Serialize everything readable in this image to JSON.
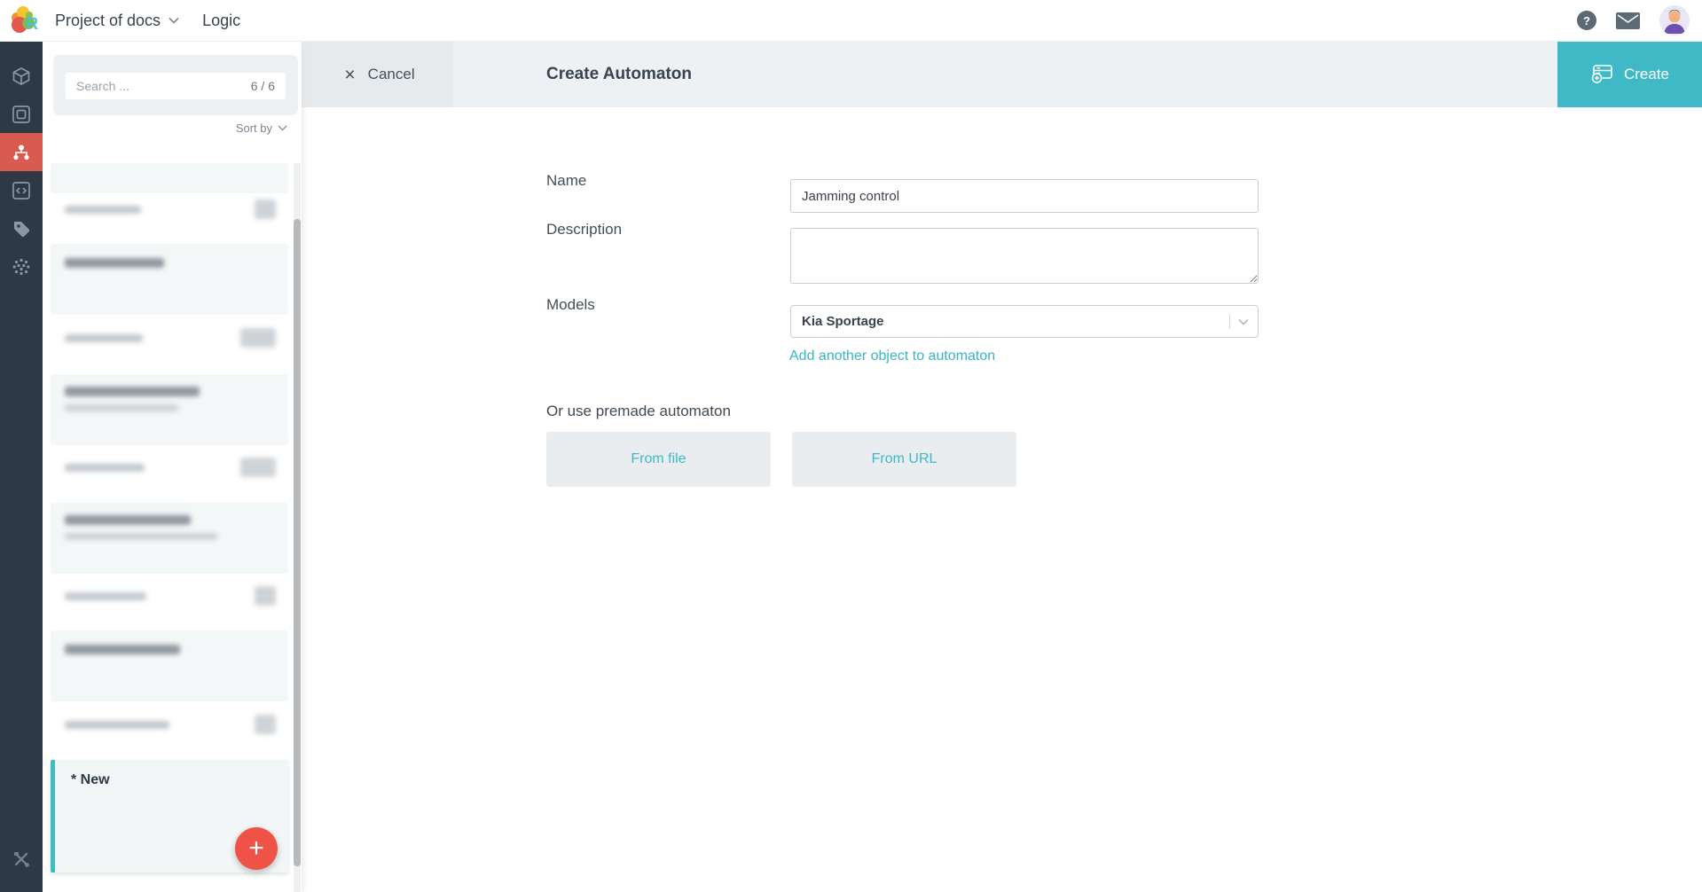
{
  "topbar": {
    "project_name": "Project of docs",
    "section": "Logic",
    "help_glyph": "?"
  },
  "panel": {
    "search_placeholder": "Search ...",
    "search_value": "",
    "counter": "6 / 6",
    "sort_label": "Sort by",
    "new_item_label": "* New",
    "add_button_glyph": "+"
  },
  "header": {
    "cancel_glyph": "×",
    "cancel_label": "Cancel",
    "title": "Create Automaton",
    "create_label": "Create"
  },
  "form": {
    "name_label": "Name",
    "name_value": "Jamming control",
    "description_label": "Description",
    "description_value": "",
    "models_label": "Models",
    "models_value": "Kia Sportage",
    "add_object_link": "Add another object to automaton",
    "premade_title": "Or use premade automaton",
    "from_file_label": "From file",
    "from_url_label": "From URL"
  },
  "colors": {
    "accent_teal": "#3fb9c6",
    "accent_red": "#ef5348",
    "active_sidebar_red": "#d95b50",
    "sidebar_bg": "#2d3945",
    "header_strip": "#eef1f3"
  }
}
